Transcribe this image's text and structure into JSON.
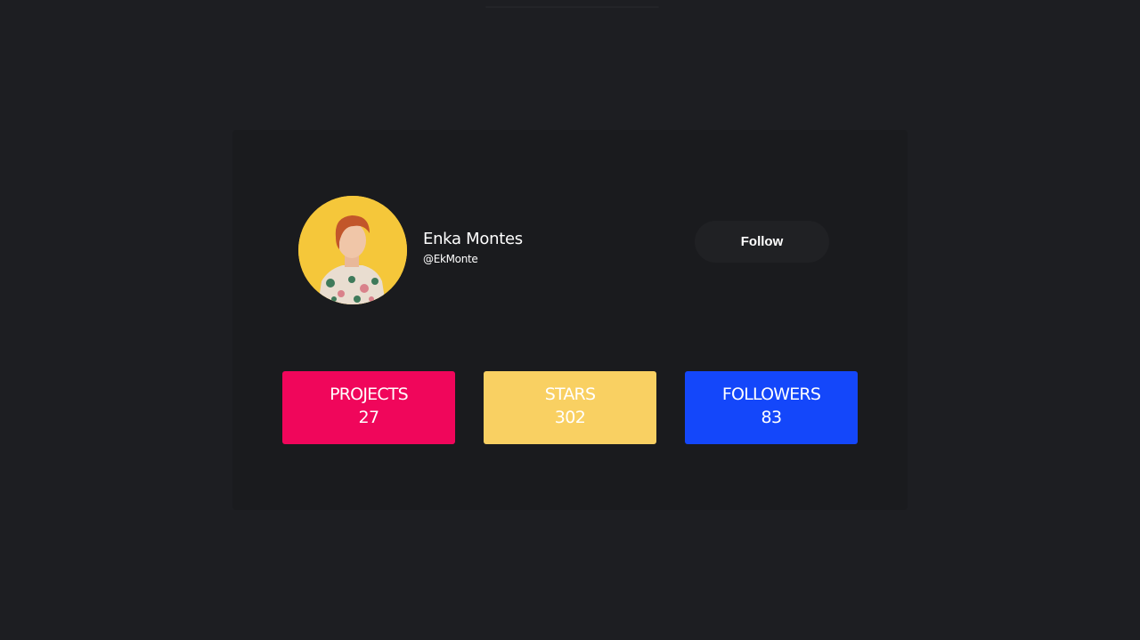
{
  "profile": {
    "name": "Enka Montes",
    "handle": "@EkMonte"
  },
  "actions": {
    "follow_label": "Follow"
  },
  "stats": [
    {
      "label": "PROJECTS",
      "value": "27",
      "color": "#f0065b"
    },
    {
      "label": "STARS",
      "value": "302",
      "color": "#f9d062"
    },
    {
      "label": "FOLLOWERS",
      "value": "83",
      "color": "#1447fa"
    }
  ],
  "colors": {
    "page_background": "#1d1e22",
    "card_background": "#1a1b1e",
    "follow_button_background": "#202124",
    "avatar_background": "#f5c73a"
  }
}
